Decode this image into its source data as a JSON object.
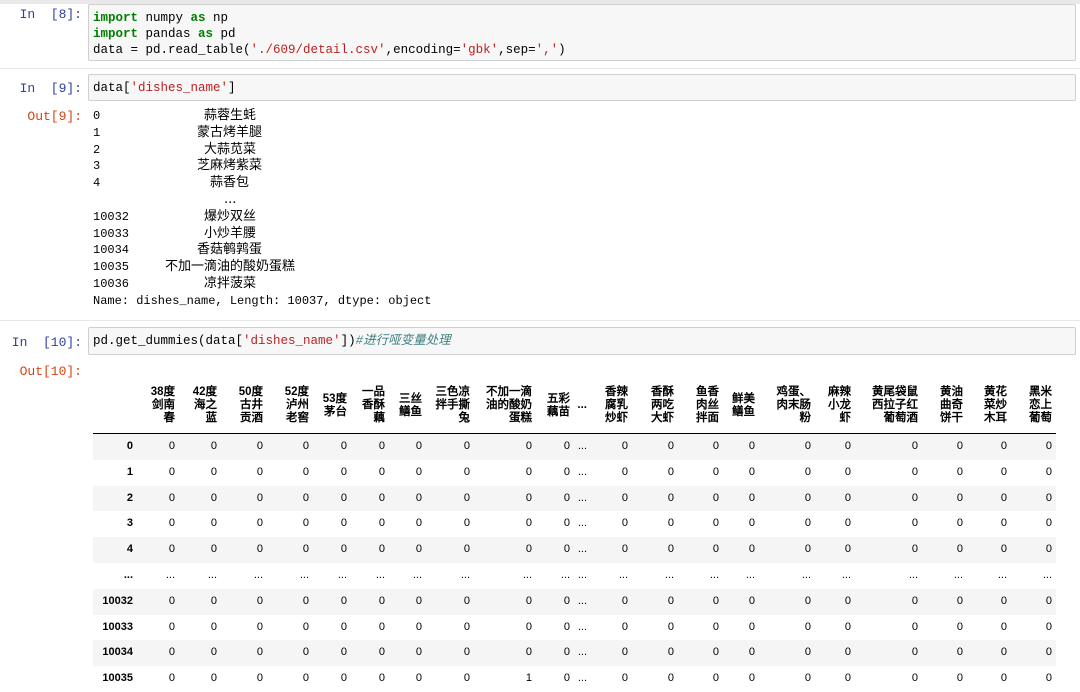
{
  "cells": [
    {
      "prompt": "In  [8]:",
      "code_lines": [
        [
          {
            "t": "import",
            "c": "kw"
          },
          {
            "t": " numpy ",
            "c": ""
          },
          {
            "t": "as",
            "c": "kw"
          },
          {
            "t": " np",
            "c": ""
          }
        ],
        [
          {
            "t": "import",
            "c": "kw"
          },
          {
            "t": " pandas ",
            "c": ""
          },
          {
            "t": "as",
            "c": "kw"
          },
          {
            "t": " pd",
            "c": ""
          }
        ],
        [
          {
            "t": "data = pd.read_table(",
            "c": ""
          },
          {
            "t": "'./609/detail.csv'",
            "c": "st"
          },
          {
            "t": ",encoding=",
            "c": ""
          },
          {
            "t": "'gbk'",
            "c": "st"
          },
          {
            "t": ",sep=",
            "c": ""
          },
          {
            "t": "','",
            "c": "st"
          },
          {
            "t": ")",
            "c": ""
          }
        ]
      ]
    },
    {
      "prompt": "In  [9]:",
      "code_lines": [
        [
          {
            "t": "data[",
            "c": ""
          },
          {
            "t": "'dishes_name'",
            "c": "st"
          },
          {
            "t": "]",
            "c": ""
          }
        ]
      ],
      "out_prompt": "Out[9]:",
      "series": [
        {
          "idx": "0",
          "val": "蒜蓉生蚝"
        },
        {
          "idx": "1",
          "val": "蒙古烤羊腿"
        },
        {
          "idx": "2",
          "val": "大蒜苋菜"
        },
        {
          "idx": "3",
          "val": "芝麻烤紫菜"
        },
        {
          "idx": "4",
          "val": "蒜香包"
        },
        {
          "idx": "",
          "val": "..."
        },
        {
          "idx": "10032",
          "val": "爆炒双丝"
        },
        {
          "idx": "10033",
          "val": "小炒羊腰"
        },
        {
          "idx": "10034",
          "val": "香菇鹌鹑蛋"
        },
        {
          "idx": "10035",
          "val": "不加一滴油的酸奶蛋糕"
        },
        {
          "idx": "10036",
          "val": "凉拌菠菜"
        }
      ],
      "series_footer": "Name: dishes_name, Length: 10037, dtype: object"
    },
    {
      "prompt": "In  [10]:",
      "code_lines": [
        [
          {
            "t": "pd.get_dummies(data[",
            "c": ""
          },
          {
            "t": "'dishes_name'",
            "c": "st"
          },
          {
            "t": "])",
            "c": ""
          },
          {
            "t": "#进行哑变量处理",
            "c": "cm"
          }
        ]
      ],
      "out_prompt": "Out[10]:"
    }
  ],
  "dataframe": {
    "columns": [
      "38度\n剑南\n春",
      "42度\n海之\n蓝",
      "50度\n古井\n贡酒",
      "52度\n泸州\n老窖",
      "53度\n茅台",
      "一品\n香酥\n藕",
      "三丝\n鳝鱼",
      "三色凉\n拌手撕\n兔",
      "不加一滴\n油的酸奶\n蛋糕",
      "五彩\n藕苗",
      "...",
      "香辣\n腐乳\n炒虾",
      "香酥\n两吃\n大虾",
      "鱼香\n肉丝\n拌面",
      "鲜美\n鳝鱼",
      "鸡蛋、\n肉末肠\n粉",
      "麻辣\n小龙\n虾",
      "黄尾袋鼠\n西拉子红\n葡萄酒",
      "黄油\n曲奇\n饼干",
      "黄花\n菜炒\n木耳",
      "黑米\n恋上\n葡萄"
    ],
    "rows": [
      {
        "index": "0",
        "values": [
          "0",
          "0",
          "0",
          "0",
          "0",
          "0",
          "0",
          "0",
          "0",
          "0",
          "...",
          "0",
          "0",
          "0",
          "0",
          "0",
          "0",
          "0",
          "0",
          "0",
          "0"
        ]
      },
      {
        "index": "1",
        "values": [
          "0",
          "0",
          "0",
          "0",
          "0",
          "0",
          "0",
          "0",
          "0",
          "0",
          "...",
          "0",
          "0",
          "0",
          "0",
          "0",
          "0",
          "0",
          "0",
          "0",
          "0"
        ]
      },
      {
        "index": "2",
        "values": [
          "0",
          "0",
          "0",
          "0",
          "0",
          "0",
          "0",
          "0",
          "0",
          "0",
          "...",
          "0",
          "0",
          "0",
          "0",
          "0",
          "0",
          "0",
          "0",
          "0",
          "0"
        ]
      },
      {
        "index": "3",
        "values": [
          "0",
          "0",
          "0",
          "0",
          "0",
          "0",
          "0",
          "0",
          "0",
          "0",
          "...",
          "0",
          "0",
          "0",
          "0",
          "0",
          "0",
          "0",
          "0",
          "0",
          "0"
        ]
      },
      {
        "index": "4",
        "values": [
          "0",
          "0",
          "0",
          "0",
          "0",
          "0",
          "0",
          "0",
          "0",
          "0",
          "...",
          "0",
          "0",
          "0",
          "0",
          "0",
          "0",
          "0",
          "0",
          "0",
          "0"
        ]
      },
      {
        "index": "...",
        "values": [
          "...",
          "...",
          "...",
          "...",
          "...",
          "...",
          "...",
          "...",
          "...",
          "...",
          "...",
          "...",
          "...",
          "...",
          "...",
          "...",
          "...",
          "...",
          "...",
          "...",
          "..."
        ]
      },
      {
        "index": "10032",
        "values": [
          "0",
          "0",
          "0",
          "0",
          "0",
          "0",
          "0",
          "0",
          "0",
          "0",
          "...",
          "0",
          "0",
          "0",
          "0",
          "0",
          "0",
          "0",
          "0",
          "0",
          "0"
        ]
      },
      {
        "index": "10033",
        "values": [
          "0",
          "0",
          "0",
          "0",
          "0",
          "0",
          "0",
          "0",
          "0",
          "0",
          "...",
          "0",
          "0",
          "0",
          "0",
          "0",
          "0",
          "0",
          "0",
          "0",
          "0"
        ]
      },
      {
        "index": "10034",
        "values": [
          "0",
          "0",
          "0",
          "0",
          "0",
          "0",
          "0",
          "0",
          "0",
          "0",
          "...",
          "0",
          "0",
          "0",
          "0",
          "0",
          "0",
          "0",
          "0",
          "0",
          "0"
        ]
      },
      {
        "index": "10035",
        "values": [
          "0",
          "0",
          "0",
          "0",
          "0",
          "0",
          "0",
          "0",
          "1",
          "0",
          "...",
          "0",
          "0",
          "0",
          "0",
          "0",
          "0",
          "0",
          "0",
          "0",
          "0"
        ]
      }
    ]
  }
}
